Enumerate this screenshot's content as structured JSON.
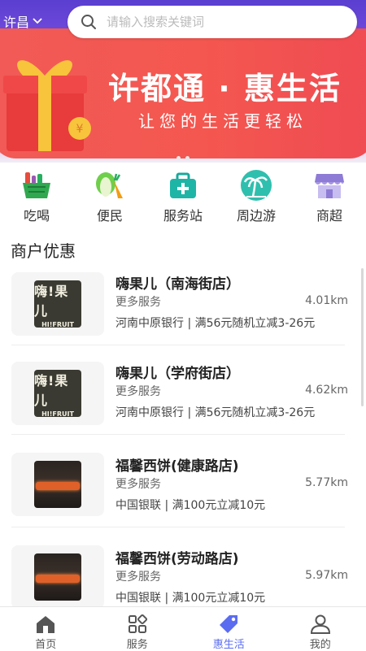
{
  "header": {
    "city": "许昌",
    "search_placeholder": "请输入搜索关键词"
  },
  "banner": {
    "title": "许都通 · 惠生活",
    "subtitle": "让您的生活更轻松"
  },
  "categories": [
    {
      "label": "吃喝",
      "icon": "basket-icon"
    },
    {
      "label": "便民",
      "icon": "vegetables-icon"
    },
    {
      "label": "服务站",
      "icon": "first-aid-kit-icon"
    },
    {
      "label": "周边游",
      "icon": "palm-tree-icon"
    },
    {
      "label": "商超",
      "icon": "store-awning-icon"
    }
  ],
  "section_title": "商户优惠",
  "merchants": [
    {
      "name": "嗨果儿（南海街店）",
      "more": "更多服务",
      "distance": "4.01km",
      "promo": "河南中原银行 | 满56元随机立减3-26元",
      "logo_text": "嗨!果儿",
      "logo_sub": "HI!FRUIT"
    },
    {
      "name": "嗨果儿（学府街店）",
      "more": "更多服务",
      "distance": "4.62km",
      "promo": "河南中原银行 | 满56元随机立减3-26元",
      "logo_text": "嗨!果儿",
      "logo_sub": "HI!FRUIT"
    },
    {
      "name": "福馨西饼(健康路店)",
      "more": "更多服务",
      "distance": "5.77km",
      "promo": "中国银联 | 满100元立减10元"
    },
    {
      "name": "福馨西饼(劳动路店)",
      "more": "更多服务",
      "distance": "5.97km",
      "promo": "中国银联 | 满100元立减10元"
    }
  ],
  "tabs": [
    {
      "label": "首页",
      "icon": "home-icon",
      "active": false
    },
    {
      "label": "服务",
      "icon": "grid-icon",
      "active": false
    },
    {
      "label": "惠生活",
      "icon": "tag-icon",
      "active": true
    },
    {
      "label": "我的",
      "icon": "user-icon",
      "active": false
    }
  ],
  "colors": {
    "accent": "#5b6cf0",
    "banner_red": "#f15a57",
    "banner_purple": "#6a48d8"
  }
}
